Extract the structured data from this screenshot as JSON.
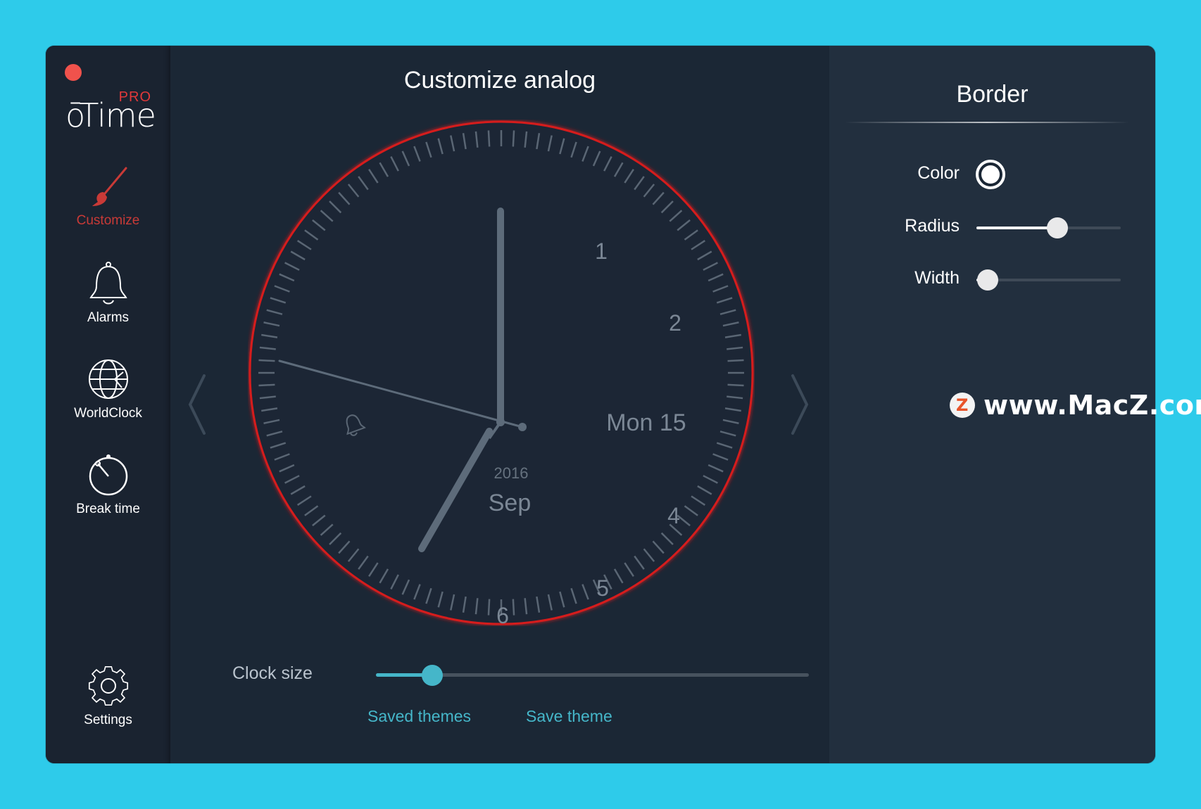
{
  "app": {
    "logo_pro": "PRO",
    "logo_name": "ōTime"
  },
  "sidebar": {
    "items": [
      {
        "label": "Customize",
        "icon": "paintbrush-icon",
        "active": true
      },
      {
        "label": "Alarms",
        "icon": "bell-icon",
        "active": false
      },
      {
        "label": "WorldClock",
        "icon": "globe-icon",
        "active": false
      },
      {
        "label": "Break time",
        "icon": "stopwatch-icon",
        "active": false
      }
    ],
    "settings_label": "Settings"
  },
  "main": {
    "title": "Customize analog",
    "clock": {
      "numerals": [
        "1",
        "2",
        "4",
        "5",
        "6"
      ],
      "day_label": "Mon 15",
      "year_label": "2016",
      "month_label": "Sep",
      "border_color": "#d61f1f",
      "alarm_icon": "bell-icon"
    },
    "clock_size_label": "Clock size",
    "clock_size_value": 0.13,
    "saved_themes_label": "Saved themes",
    "save_theme_label": "Save theme"
  },
  "panel": {
    "title": "Border",
    "color_label": "Color",
    "color_value": "#ffffff",
    "radius_label": "Radius",
    "radius_value": 0.56,
    "width_label": "Width",
    "width_value": 0.08
  },
  "watermark": {
    "badge": "Z",
    "text": "www.MacZ.com"
  },
  "colors": {
    "background": "#2ecbea",
    "accent_red": "#c93a37",
    "link": "#45b6c9"
  }
}
